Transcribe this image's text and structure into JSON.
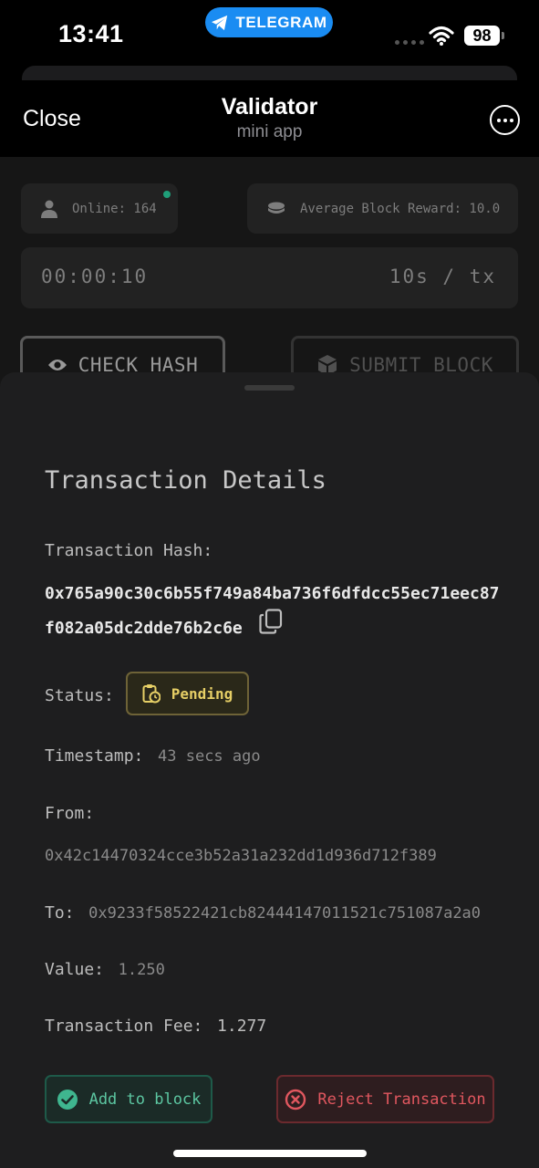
{
  "status_bar": {
    "time": "13:41",
    "telegram_pill": "TELEGRAM",
    "battery": "98"
  },
  "header": {
    "close_label": "Close",
    "title": "Validator",
    "subtitle": "mini app"
  },
  "stats": {
    "online": "Online: 164",
    "average_block_reward": "Average Block Reward: 10.0"
  },
  "timer": {
    "elapsed": "00:00:10",
    "rate": "10s / tx"
  },
  "actions": {
    "check_hash": "CHECK HASH",
    "submit_block": "SUBMIT BLOCK"
  },
  "sheet": {
    "title": "Transaction Details",
    "hash_label": "Transaction Hash:",
    "hash_line1": "0x765a90c30c6b55f749a84ba736f6dfdcc55ec71eec87",
    "hash_line2": "f082a05dc2dde76b2c6e",
    "status_label": "Status:",
    "status_value": "Pending",
    "timestamp_label": "Timestamp:",
    "timestamp_value": "43 secs ago",
    "from_label": "From:",
    "from_value": "0x42c14470324cce3b52a31a232dd1d936d712f389",
    "to_label": "To:",
    "to_value": "0x9233f58522421cb82444147011521c751087a2a0",
    "value_label": "Value:",
    "value_value": "1.250",
    "fee_label": "Transaction Fee:",
    "fee_value": "1.277",
    "add_button": "Add to block",
    "reject_button": "Reject Transaction"
  },
  "colors": {
    "telegram_blue": "#1a8cf2",
    "online_dot": "#1f9f79",
    "pending": "#e6cf66",
    "accept": "#5cc6a1",
    "reject": "#e1575f"
  }
}
